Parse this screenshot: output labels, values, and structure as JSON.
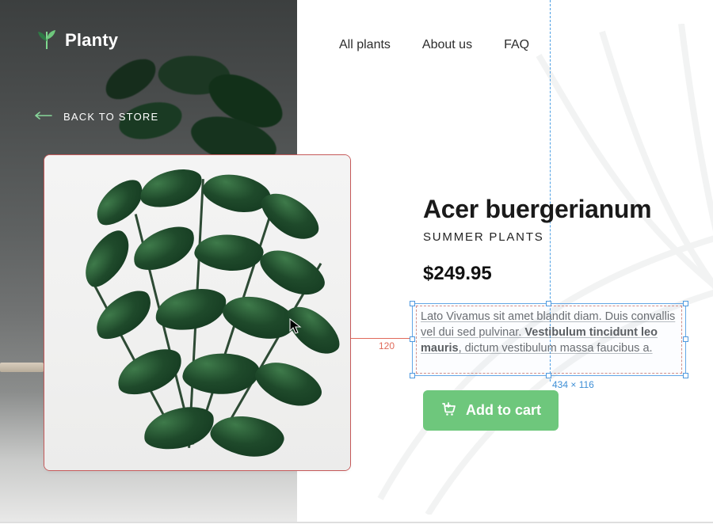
{
  "brand": {
    "name": "Planty"
  },
  "nav": {
    "all_plants": "All plants",
    "about": "About us",
    "faq": "FAQ"
  },
  "back": {
    "label": "BACK TO STORE"
  },
  "product": {
    "title": "Acer buergerianum",
    "category": "SUMMER PLANTS",
    "price": "$249.95",
    "description_prefix": "Lato Vivamus sit amet blandit diam. Duis convallis vel dui sed pulvinar. ",
    "description_bold": "Vestibulum tincidunt leo mauris",
    "description_suffix": ", dictum vestibulum massa faucibus a.",
    "cta": "Add to cart"
  },
  "editor": {
    "gap_measure": "120",
    "selection_dims": "434 × 116"
  },
  "colors": {
    "accent": "#6ec77c",
    "select": "#4e99df",
    "warn": "#e06a5a"
  }
}
